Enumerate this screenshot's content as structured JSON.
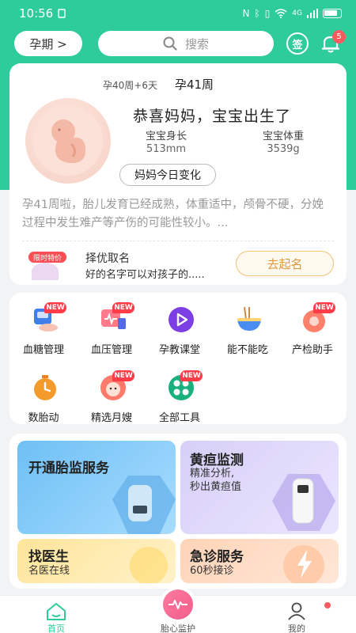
{
  "status": {
    "time": "10:56",
    "signal": "4G"
  },
  "header": {
    "stage_label": "孕期 >",
    "search_placeholder": "搜索",
    "sign_label": "签",
    "notif_count": "5"
  },
  "pregnancy": {
    "prev_week": "孕40周+6天",
    "current_week": "孕41周",
    "congrats": "恭喜妈妈，宝宝出生了",
    "length_label": "宝宝身长",
    "length_value": "513mm",
    "weight_label": "宝宝体重",
    "weight_value": "3539g",
    "today_change_label": "妈妈今日变化",
    "description": "孕41周啦，胎儿发育已经成熟，体重适中，颅骨不硬，分娩过程中发生难产等产伤的可能性较小。..."
  },
  "promo": {
    "tag": "限时特价",
    "title": "择优取名",
    "subtitle": "好的名字可以对孩子的.....",
    "button": "去起名"
  },
  "tools": {
    "new_badge": "NEW",
    "items": [
      {
        "label": "血糖管理",
        "icon": "blood-sugar-icon",
        "new": true
      },
      {
        "label": "血压管理",
        "icon": "blood-pressure-icon",
        "new": true
      },
      {
        "label": "孕教课堂",
        "icon": "play-class-icon",
        "new": false
      },
      {
        "label": "能不能吃",
        "icon": "food-bowl-icon",
        "new": false
      },
      {
        "label": "产检助手",
        "icon": "checkup-icon",
        "new": true
      },
      {
        "label": "数胎动",
        "icon": "timer-icon",
        "new": false
      },
      {
        "label": "精选月嫂",
        "icon": "nanny-icon",
        "new": true
      },
      {
        "label": "全部工具",
        "icon": "all-tools-icon",
        "new": true
      }
    ]
  },
  "services": {
    "fetal_monitor": {
      "title": "开通胎监服务"
    },
    "jaundice": {
      "title": "黄疸监测",
      "sub1": "精准分析,",
      "sub2": "秒出黄疸值"
    },
    "doctor": {
      "title": "找医生",
      "sub": "名医在线"
    },
    "emergency": {
      "title": "急诊服务",
      "sub": "60秒接诊"
    }
  },
  "tabbar": {
    "home": "首页",
    "monitor": "胎心监护",
    "mine": "我的"
  },
  "colors": {
    "brand": "#2ecb9b",
    "accent": "#ff5a5f",
    "promo": "#e0963a"
  }
}
